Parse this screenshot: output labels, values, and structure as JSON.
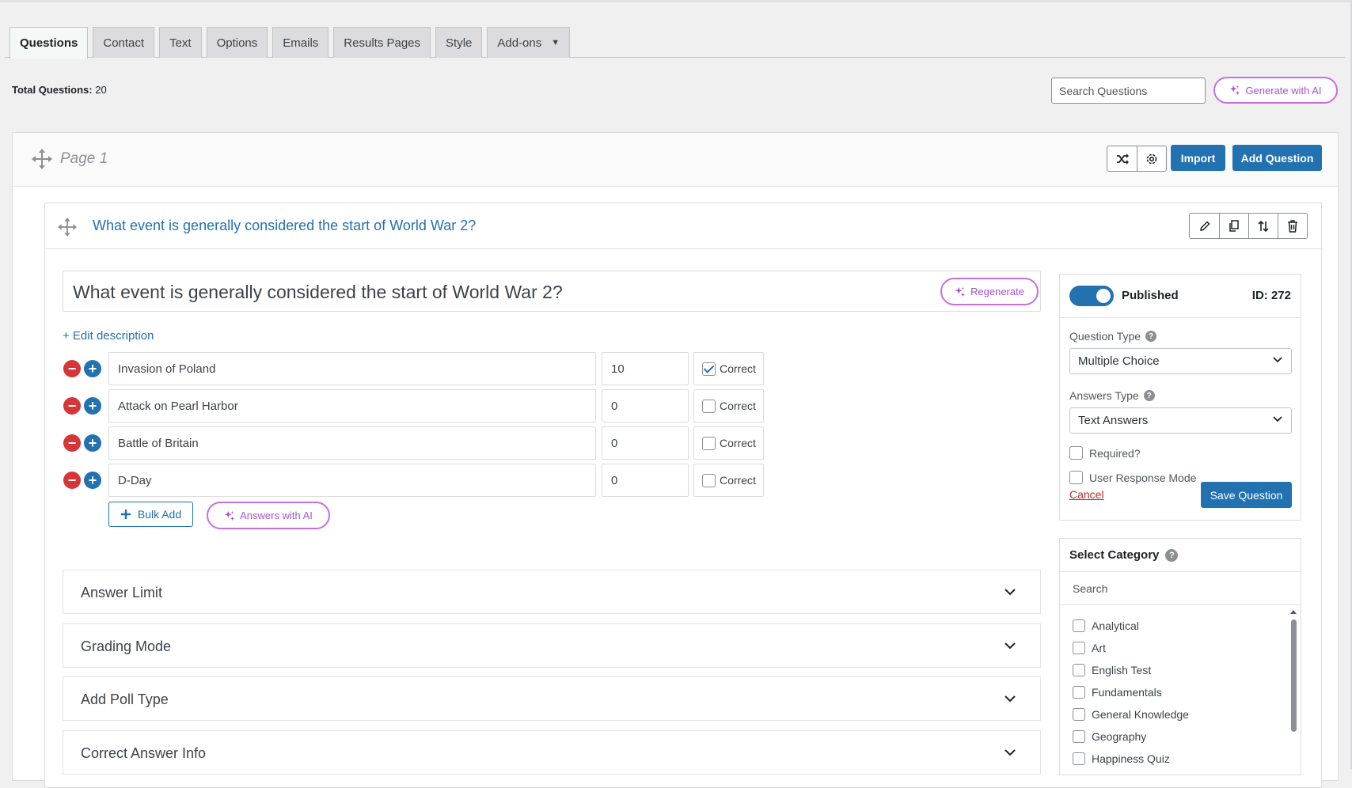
{
  "tabs": [
    {
      "label": "Questions"
    },
    {
      "label": "Contact"
    },
    {
      "label": "Text"
    },
    {
      "label": "Options"
    },
    {
      "label": "Emails"
    },
    {
      "label": "Results Pages"
    },
    {
      "label": "Style"
    },
    {
      "label": "Add-ons"
    }
  ],
  "summary": {
    "total_label": "Total Questions:",
    "total_value": "20"
  },
  "toolbar": {
    "search_placeholder": "Search Questions",
    "generate_ai": "Generate with AI"
  },
  "page": {
    "title": "Page 1",
    "import_label": "Import",
    "add_question_label": "Add Question"
  },
  "question": {
    "title": "What event is generally considered the start of World War 2?",
    "text": "What event is generally considered the start of World War 2?",
    "regenerate_label": "Regenerate",
    "edit_description": "+ Edit description",
    "answers": [
      {
        "text": "Invasion of Poland",
        "points": "10",
        "correct_label": "Correct",
        "correct": true
      },
      {
        "text": "Attack on Pearl Harbor",
        "points": "0",
        "correct_label": "Correct",
        "correct": false
      },
      {
        "text": "Battle of Britain",
        "points": "0",
        "correct_label": "Correct",
        "correct": false
      },
      {
        "text": "D-Day",
        "points": "0",
        "correct_label": "Correct",
        "correct": false
      }
    ],
    "bulk_add": "Bulk Add",
    "answers_ai": "Answers with AI",
    "accordions": [
      {
        "label": "Answer Limit"
      },
      {
        "label": "Grading Mode"
      },
      {
        "label": "Add Poll Type"
      },
      {
        "label": "Correct Answer Info"
      }
    ]
  },
  "sidebar": {
    "published_label": "Published",
    "id_label": "ID: 272",
    "question_type_label": "Question Type",
    "question_type_value": "Multiple Choice",
    "answers_type_label": "Answers Type",
    "answers_type_value": "Text Answers",
    "required_label": "Required?",
    "user_response_label": "User Response Mode",
    "cancel_label": "Cancel",
    "save_label": "Save Question"
  },
  "categories": {
    "title": "Select Category",
    "search_placeholder": "Search",
    "items": [
      "Analytical",
      "Art",
      "English Test",
      "Fundamentals",
      "General Knowledge",
      "Geography",
      "Happiness Quiz"
    ]
  },
  "colors": {
    "accent": "#2271b1",
    "danger": "#d63638",
    "ai_purple": "#c56fe3"
  }
}
